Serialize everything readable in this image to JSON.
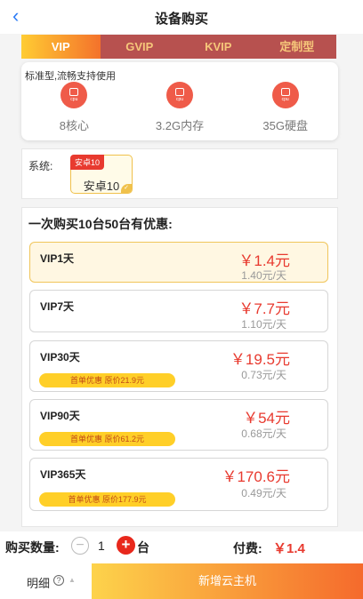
{
  "header": {
    "title": "设备购买",
    "back_icon": "chevron-left-icon"
  },
  "tabs": [
    {
      "label": "VIP",
      "active": true
    },
    {
      "label": "GVIP",
      "active": false
    },
    {
      "label": "KVIP",
      "active": false
    },
    {
      "label": "定制型",
      "active": false
    }
  ],
  "spec": {
    "caption": "标准型,流畅支持使用",
    "items": [
      {
        "icon": "cpu-icon",
        "icon_label": "cpu",
        "label": "8核心"
      },
      {
        "icon": "cpu-icon",
        "icon_label": "cpu",
        "label": "3.2G内存"
      },
      {
        "icon": "cpu-icon",
        "icon_label": "cpu",
        "label": "35G硬盘"
      }
    ]
  },
  "system": {
    "label": "系统:",
    "badge": "安卓10",
    "option": "安卓10"
  },
  "packages": {
    "heading": "一次购买10台50台有优惠:",
    "plans": [
      {
        "name": "VIP1天",
        "price": "￥1.4元",
        "unit_price": "1.40元/天",
        "promo": "",
        "selected": true
      },
      {
        "name": "VIP7天",
        "price": "￥7.7元",
        "unit_price": "1.10元/天",
        "promo": "",
        "selected": false
      },
      {
        "name": "VIP30天",
        "price": "￥19.5元",
        "unit_price": "0.73元/天",
        "promo": "首单优惠 原价21.9元",
        "selected": false
      },
      {
        "name": "VIP90天",
        "price": "￥54元",
        "unit_price": "0.68元/天",
        "promo": "首单优惠 原价61.2元",
        "selected": false
      },
      {
        "name": "VIP365天",
        "price": "￥170.6元",
        "unit_price": "0.49元/天",
        "promo": "首单优惠 原价177.9元",
        "selected": false
      }
    ]
  },
  "purchase": {
    "qty_label": "购买数量:",
    "minus": "−",
    "qty": "1",
    "plus": "+",
    "qty_unit": "台",
    "pay_label": "付费:",
    "pay_value": "￥1.4"
  },
  "footer": {
    "detail_label": "明细",
    "help": "?",
    "caret": "▲",
    "create_label": "新增云主机"
  },
  "colors": {
    "accent": "#e83a2f",
    "tab_bar": "#b7514f",
    "promo": "#ffcf28",
    "link": "#2d7cf6"
  }
}
